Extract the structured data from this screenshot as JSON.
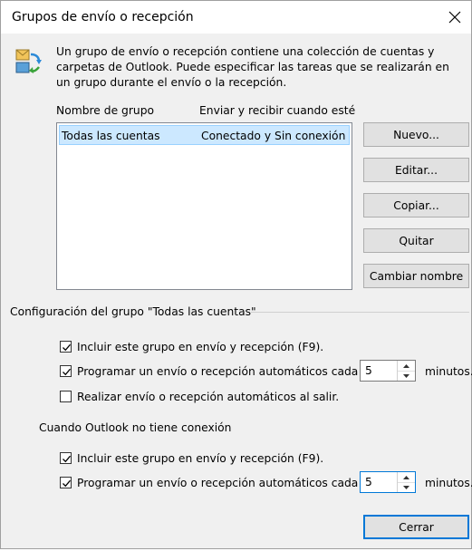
{
  "window": {
    "title": "Grupos de envío o recepción",
    "close_icon": "close-icon"
  },
  "info": {
    "icon": "send-receive-icon",
    "description": "Un grupo de envío o recepción contiene una colección de cuentas y carpetas de Outlook. Puede especificar las tareas que se realizarán en un grupo durante el envío o la recepción."
  },
  "list": {
    "headers": [
      "Nombre de grupo",
      "Enviar y recibir cuando esté"
    ],
    "rows": [
      {
        "name": "Todas las cuentas",
        "mode": "Conectado y Sin conexión",
        "selected": true
      }
    ]
  },
  "buttons": {
    "new": "Nuevo...",
    "edit": "Editar...",
    "copy": "Copiar...",
    "remove": "Quitar",
    "rename": "Cambiar nombre",
    "close": "Cerrar"
  },
  "group_settings": {
    "title": "Configuración del grupo \"Todas las cuentas\"",
    "online": {
      "include": {
        "label": "Incluir este grupo en envío y recepción (F9).",
        "checked": true
      },
      "schedule": {
        "label": "Programar un envío o recepción automáticos cada",
        "checked": true,
        "value": "5",
        "unit": "minutos."
      },
      "on_exit": {
        "label": "Realizar envío o recepción automáticos al salir.",
        "checked": false
      }
    },
    "offline_title": "Cuando Outlook no tiene conexión",
    "offline": {
      "include": {
        "label": "Incluir este grupo en envío y recepción (F9).",
        "checked": true
      },
      "schedule": {
        "label": "Programar un envío o recepción automáticos cada",
        "checked": true,
        "value": "5",
        "unit": "minutos."
      }
    }
  },
  "colors": {
    "selection": "#cce8ff",
    "accent": "#0078d7",
    "dialog_bg": "#f0f0f0"
  }
}
